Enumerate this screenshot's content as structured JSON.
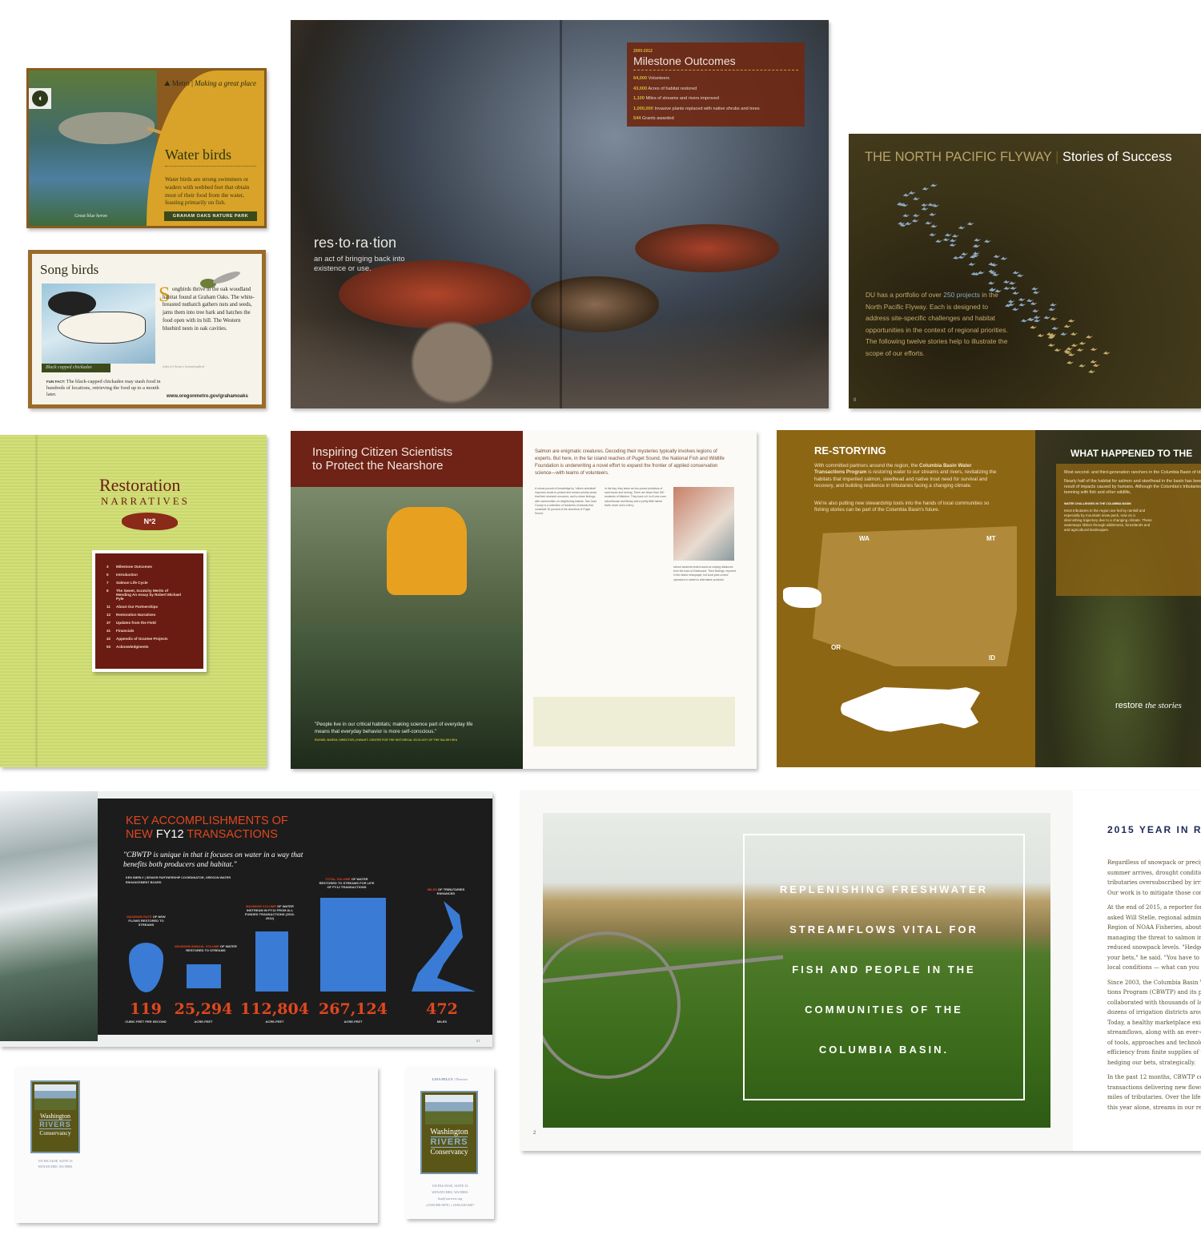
{
  "colors": {
    "metro_gold": "#d8a328",
    "maroon": "#6b1c12",
    "lime": "#cddc6a",
    "olive": "#3c3418",
    "ochre": "#8d6614",
    "accent_orange": "#e0471e",
    "water_blue": "#3a7bd5",
    "wrc_green": "#5a5618",
    "wrc_blue": "#7896ae"
  },
  "water_birds": {
    "brand": "Metro",
    "tagline": "Making a great place",
    "title": "Water birds",
    "body": "Water birds are strong swimmers or waders with webbed feet that obtain most of their food from the water, feasting primarily on fish.",
    "caption": "Great blue heron",
    "button": "GRAHAM OAKS NATURE PARK",
    "icon": "duck-icon"
  },
  "song_birds": {
    "title": "Song birds",
    "dropcap": "S",
    "body": "ongbirds thrive in the oak woodland habitat found at Graham Oaks. The white-breasted nuthatch gathers nuts and seeds, jams them into tree bark and hatches the food open with its bill. The Western bluebird nests in oak cavities.",
    "hummingbird_caption": "(above) Anna's hummingbird",
    "photo_caption": "Black capped chickadee",
    "fun_fact_label": "FUN FACT:",
    "fun_fact": "The black-capped chickadee may stash food in hundreds of locations, retrieving the food up to a month later.",
    "url": "www.oregonmetro.gov/grahamoaks"
  },
  "salmon_spread": {
    "word": "res·to·ra·tion",
    "definition": "an act of bringing back into existence or use.",
    "milestones": {
      "years": "2000-2012",
      "title": "Milestone Outcomes",
      "items": [
        {
          "value": "64,000",
          "label": "Volunteers"
        },
        {
          "value": "43,000",
          "label": "Acres of habitat restored"
        },
        {
          "value": "1,100",
          "label": "Miles of streams and rivers improved"
        },
        {
          "value": "1,000,000",
          "label": "Invasive plants replaced with native shrubs and trees"
        },
        {
          "value": "544",
          "label": "Grants awarded"
        }
      ]
    }
  },
  "flyway": {
    "title_a": "THE NORTH PACIFIC FLYWAY",
    "title_b": "Stories of Success",
    "body_a": "DU has a portfolio of over ",
    "highlight": "250 projects",
    "body_b": " in the North Pacific Flyway. Each is designed to address site-specific challenges and habitat opportunities in the context of regional priorities. The following twelve stories help to illustrate the scope of our efforts.",
    "page": "8"
  },
  "narratives": {
    "title": "Restoration",
    "subtitle": "NARRATIVES",
    "issue": "Nº2",
    "toc": [
      {
        "page": "3",
        "title": "Milestone Outcomes"
      },
      {
        "page": "5",
        "title": "Introduction"
      },
      {
        "page": "7",
        "title": "Salmon Life Cycle"
      },
      {
        "page": "8",
        "title": "The Sweet, Scratchy Merits of Mending An essay by Robert Michael Pyle"
      },
      {
        "page": "11",
        "title": "About Our Partnerships"
      },
      {
        "page": "12",
        "title": "Restoration Narratives"
      },
      {
        "page": "37",
        "title": "Updates from the Field"
      },
      {
        "page": "41",
        "title": "Financials"
      },
      {
        "page": "42",
        "title": "Appendix of Grantee Projects"
      },
      {
        "page": "53",
        "title": "Acknowledgments"
      }
    ]
  },
  "citizen": {
    "title_a": "Inspiring ",
    "title_b": "Citizen Scientists",
    "title_c": "to Protect the Nearshore",
    "intro": "Salmon are enigmatic creatures. Decoding their mysteries typically involves legions of experts. But here, in the far island reaches of Puget Sound, the National Fish and Wildlife Foundation is underwriting a novel effort to expand the frontier of applied conservation science—with teams of volunteers.",
    "quote": "\"People live in our critical habitats; making science part of everyday life means that everyday behavior is more self-conscious.\"",
    "attribution": "RUSSEL BARSH, DIRECTOR | KWIAHT: CENTER FOR THE HISTORICAL ECOLOGY OF THE SALISH SEA",
    "col1": "A robust pursuit of knowledge by \"citizen scientists\" improves locals to protect and restore priority areas that their research uncovers, and to share findings with communities on neighboring islands. San Juan County is a collection of hundreds of islands that constitute 30 percent of the shoreline of Puget Sound.",
    "col2": "In the bay, they leave as two-pound predators of sand lance and herring. There are fewer than 300 residents of Waldron. They have a K-to-8 one-room schoolhouse and library and a pretty little harbor that's never seen a ferry.",
    "col3": "school students tested clams at varying distances from the town of Eastsound. Their findings, reported in the island newspaper, led local pest-control operators to switch to alternative products."
  },
  "restorying": {
    "title": "RE-STORYING",
    "p1a": "With committed partners around the region, the ",
    "p1b": "Columbia Basin Water Transactions Program",
    "p1c": " is restoring water to our streams and rivers, revitalizing the habitats that imperiled salmon, steelhead and native trout need for survival and recovery, and building resilience in tributaries facing a changing climate.",
    "p2": "We're also putting new stewardship tools into the hands of local communities so fishing stories can be part of the Columbia Basin's future.",
    "map_labels": [
      "WA",
      "MT",
      "OR",
      "ID"
    ],
    "right_title": "WHAT HAPPENED TO THE",
    "right_p1": "Most second- and third-generation ranchers in the Columbia Basin of Idaho, Oregon, Washington and Montana can tell a good fishing story: tales from their parents, who heard them from their parents. Many ranchers don't have a fishing story of their own.",
    "right_p2": "Nearly half of the habitat for salmon and steelhead in the basin has been lost as a result of impacts caused by humans. Although the Columbia's tributaries were once teeming with fish and other wildlife,",
    "box_title": "WATER CHALLENGES IN THE COLUMBIA BASIN",
    "box_text": "Most tributaries in the region are fed by rainfall and especially by mountain snow pack, now on a diminishing trajectory due to a changing climate. These waterways ribbon through wilderness, forestlands and arid agricultural landscapes.",
    "tagline_a": "restore ",
    "tagline_b": "the stories"
  },
  "accomplishments": {
    "title_a": "KEY ACCOMPLISHMENTS OF",
    "title_b": "NEW ",
    "title_c": "FY12",
    "title_d": " TRANSACTIONS",
    "quote": "\"CBWTP is unique in that it focuses on water in a way that benefits both producers and habitat.\"",
    "attribution": "KEN BIERLY | SENIOR PARTNERSHIP COORDINATOR, OREGON WATER ENHANCEMENT BOARD",
    "page": "27",
    "stats": [
      {
        "value": "119",
        "unit": "CUBIC FEET PER SECOND",
        "cap_hl": "MAXIMUM RATE",
        "cap": " OF NEW FLOWS RESTORED TO STREAMS"
      },
      {
        "value": "25,294",
        "unit": "ACRE-FEET",
        "cap_hl": "MAXIMUM ANNUAL VOLUME",
        "cap": " OF WATER RESTORED TO STREAMS"
      },
      {
        "value": "112,804",
        "unit": "ACRE-FEET",
        "cap_hl": "MAXIMUM VOLUME",
        "cap": " OF WATER INSTREAM IN FY12 FROM ALL FUNDED TRANSACTIONS (2003-2012)"
      },
      {
        "value": "267,124",
        "unit": "ACRE-FEET",
        "cap_hl": "TOTAL VOLUME",
        "cap": " OF WATER RESTORED TO STREAMS FOR LIFE OF FY12 TRANSACTIONS"
      },
      {
        "value": "472",
        "unit": "MILES",
        "cap_hl": "MILES",
        "cap": " OF TRIBUTARIES ENHANCED"
      }
    ]
  },
  "stationery": {
    "logo_a": "Washington",
    "logo_b": "RIVERS",
    "logo_c": "Conservancy",
    "address1": "105 PALOUSE, SUITE 33",
    "address2": "WENATCHEE, WA 98801",
    "card_name": "LISA PELLY",
    "card_title": "Director",
    "email": "lisa@warivers.org",
    "phones": "t (509) 888-0970 | c (509) 630-0467"
  },
  "freshwater": {
    "lines": [
      "REPLENISHING FRESHWATER",
      "STREAMFLOWS VITAL FOR",
      "FISH AND PEOPLE IN THE",
      "COMMUNITIES OF THE",
      "COLUMBIA BASIN."
    ],
    "page": "2",
    "year_title": "2015 YEAR IN R",
    "paras": [
      "Regardless of snowpack or precip\nsummer arrives, drought conditio\ntributaries oversubscribed by irri\nOur work is to mitigate those con",
      "At the end of 2015, a reporter for\nasked Will Stelle, regional admini\nRegion of NOAA Fisheries, about h\nmanaging the threat to salmon in\nreduced snowpack levels. \"Hedge\nyour bets,\" he said. \"You have to b\nlocal conditions — what can you",
      "Since 2003, the Columbia Basin W\ntions Program (CBWTP) and its p\ncollaborated with thousands of la\ndozens of irrigation districts arou\nToday, a healthy marketplace exis\nstreamflows, along with an ever-e\nof tools, approaches and technolo\nefficiency from finite supplies of w\nhedging our bets, strategically.",
      "In the past 12 months, CBWTP co\ntransactions delivering new flows\nmiles of tributaries. Over the life\nthis year alone, streams in our reg"
    ]
  }
}
